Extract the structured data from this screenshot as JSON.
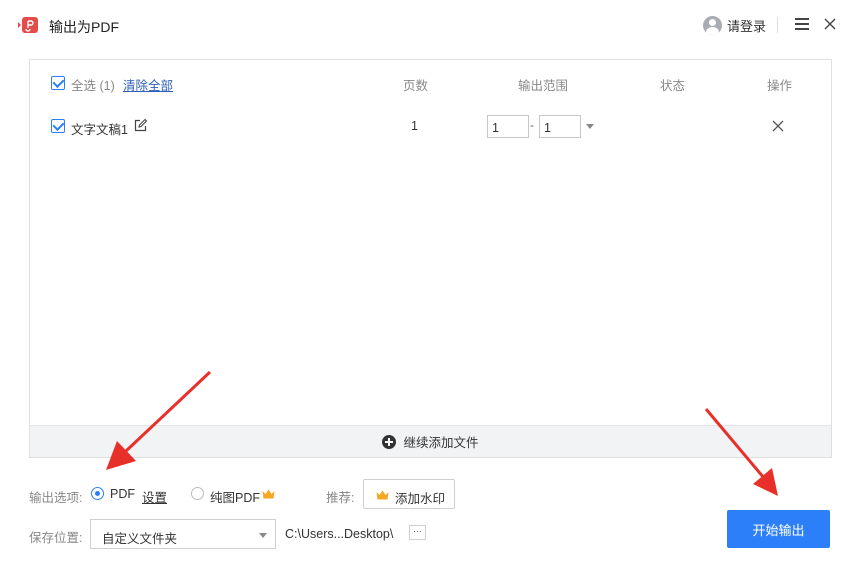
{
  "window": {
    "title": "输出为PDF",
    "login_label": "请登录"
  },
  "file_list": {
    "header": {
      "select_all": "全选 (1)",
      "clear_all": "清除全部",
      "col_pages": "页数",
      "col_range": "输出范围",
      "col_status": "状态",
      "col_actions": "操作"
    },
    "items": [
      {
        "name": "文字文稿1",
        "checked": true,
        "pages": "1",
        "range_start": "1",
        "range_sep": "-",
        "range_end": "1",
        "status": ""
      }
    ],
    "add_more_label": "继续添加文件"
  },
  "output_options": {
    "label": "输出选项:",
    "pdf_label": "PDF",
    "pdf_selected": true,
    "settings_label": "设置",
    "image_pdf_label": "纯图PDF",
    "recommend_label": "推荐:",
    "watermark_label": "添加水印"
  },
  "save_location": {
    "label": "保存位置:",
    "selected": "自定义文件夹",
    "path": "C:\\Users...Desktop\\",
    "browse_label": "···"
  },
  "start_button_label": "开始输出",
  "colors": {
    "accent": "#2d7ff9",
    "annotation": "#e8302a",
    "crown": "#f5a623",
    "app_icon": "#e64b4b"
  },
  "icons": [
    "app-logo-icon",
    "avatar-icon",
    "menu-icon",
    "close-icon",
    "edit-icon",
    "remove-icon",
    "plus-circle-icon",
    "crown-icon"
  ]
}
